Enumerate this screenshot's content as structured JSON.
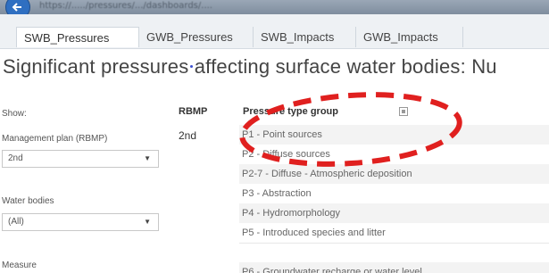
{
  "browser": {
    "url_text": "https://...../pressures/.../dashboards/...."
  },
  "tabs": [
    {
      "label": "SWB_Pressures",
      "active": true
    },
    {
      "label": "GWB_Pressures",
      "active": false
    },
    {
      "label": "SWB_Impacts",
      "active": false
    },
    {
      "label": "GWB_Impacts",
      "active": false
    }
  ],
  "page_title": "Significant pressures affecting surface water bodies: Nu",
  "filters": {
    "show_label": "Show:",
    "management_plan": {
      "label": "Management plan (RBMP)",
      "value": "2nd"
    },
    "water_bodies": {
      "label": "Water bodies",
      "value": "(All)"
    },
    "measure": {
      "label": "Measure"
    }
  },
  "table": {
    "headers": {
      "rbmp": "RBMP",
      "pressure_type_group": "Pressure type group"
    },
    "rbmp_value": "2nd",
    "rows": [
      "P1 - Point sources",
      "P2 - Diffuse sources",
      "P2-7 - Diffuse - Atmospheric deposition",
      "P3 - Abstraction",
      "P4 - Hydromorphology",
      "P5 - Introduced species and litter",
      "P6 - Groundwater recharge or water level"
    ]
  },
  "colors": {
    "annotation_red": "#e0201f",
    "tab_bar": "#eef1f4",
    "row_alt": "#f3f3f3"
  }
}
